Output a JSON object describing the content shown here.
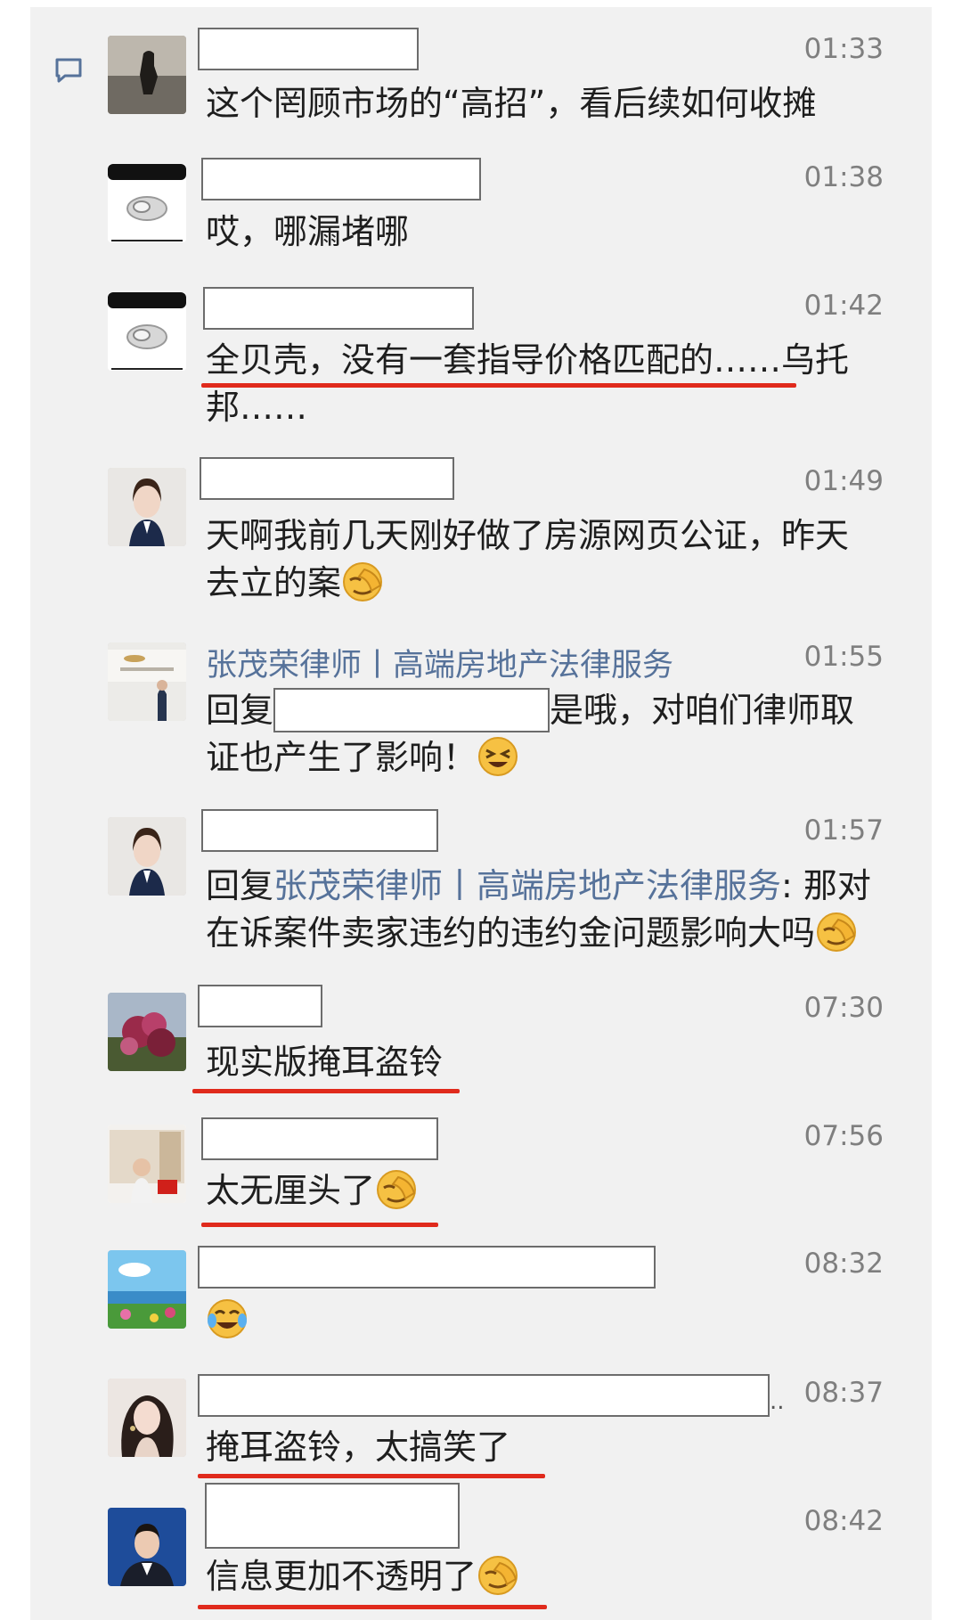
{
  "messages": [
    {
      "time": "01:33",
      "line1": "这个罔顾市场的“高招”，看后续如何收摊"
    },
    {
      "time": "01:38",
      "line1": "哎，哪漏堵哪"
    },
    {
      "time": "01:42",
      "line1": "全贝壳，没有一套指导价格匹配的……乌托",
      "line2": "邦……"
    },
    {
      "time": "01:49",
      "line1": "天啊我前几天刚好做了房源网页公证，昨天",
      "line2": "去立的案"
    },
    {
      "time": "01:55",
      "name": "张茂荣律师丨高端房地产法律服务",
      "prefix": "回复",
      "suffix": "是哦，对咱们律师取",
      "line2": "证也产生了影响！"
    },
    {
      "time": "01:57",
      "prefix": "回复",
      "reply_to": "张茂荣律师丨高端房地产法律服务",
      "suffix": ": 那对",
      "line2": "在诉案件卖家违约的违约金问题影响大吗"
    },
    {
      "time": "07:30",
      "line1": "现实版掩耳盗铃"
    },
    {
      "time": "07:56",
      "line1": "太无厘头了"
    },
    {
      "time": "08:32"
    },
    {
      "time": "08:37",
      "line1": "掩耳盗铃，太搞笑了",
      "name_overflow": ".."
    },
    {
      "time": "08:42",
      "line1": "信息更加不透明了"
    }
  ],
  "colors": {
    "underline": "#e02a1c",
    "link": "#56729a",
    "panel": "#f1f1f1"
  }
}
